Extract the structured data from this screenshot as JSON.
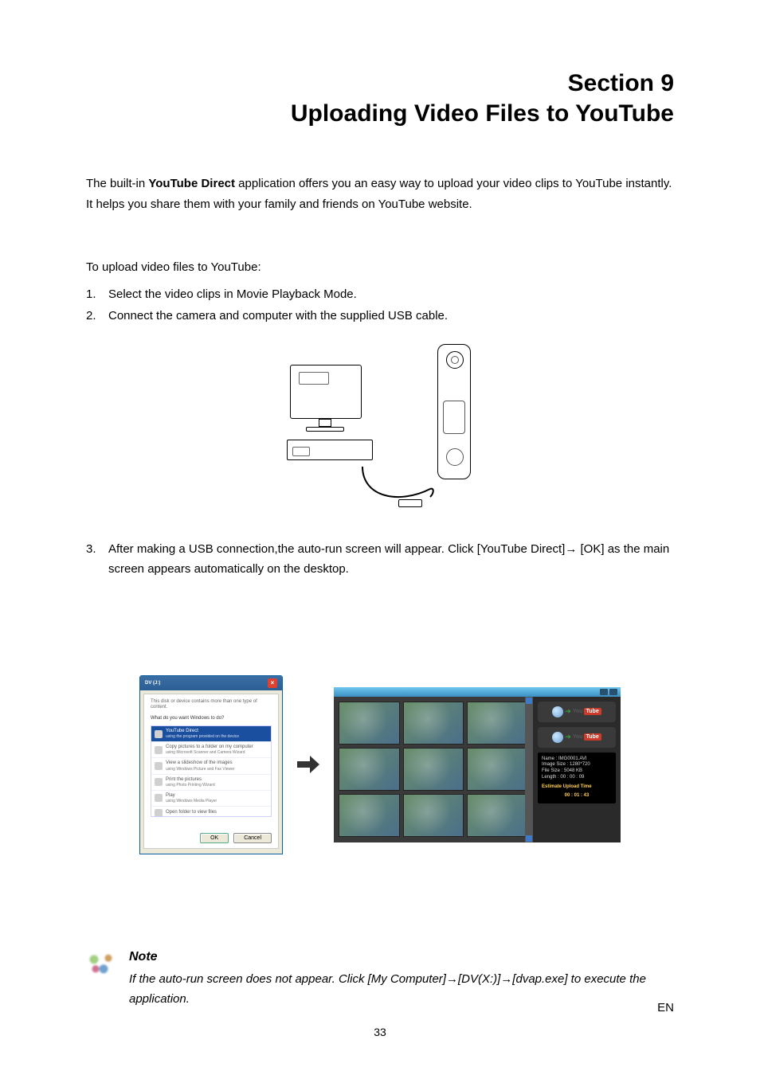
{
  "section": "Section 9",
  "title": "Uploading Video Files to YouTube",
  "intro": {
    "pre": "The built-in ",
    "bold": "YouTube Direct",
    "post": " application offers you an easy way to upload your video clips to YouTube instantly. It helps you share them with your family and friends on YouTube website."
  },
  "lead": "To upload video files to YouTube:",
  "steps": [
    {
      "num": "1.",
      "text": "Select the video clips in Movie Playback Mode."
    },
    {
      "num": "2.",
      "text": "Connect the camera and computer with the supplied USB cable."
    }
  ],
  "step3": {
    "num": "3.",
    "text": "After making a USB connection,the auto-run screen will appear. Click [YouTube Direct]→ [OK] as the main screen appears automatically on the desktop."
  },
  "dialog": {
    "title": "DV (J:)",
    "msg": "This disk or device contains more than one type of content.",
    "question": "What do you want Windows to do?",
    "options": [
      {
        "label": "YouTube Direct",
        "sub": "using the program provided on the device",
        "hl": true
      },
      {
        "label": "Copy pictures to a folder on my computer",
        "sub": "using Microsoft Scanner and Camera Wizard",
        "hl": false
      },
      {
        "label": "View a slideshow of the images",
        "sub": "using Windows Picture and Fax Viewer",
        "hl": false
      },
      {
        "label": "Print the pictures",
        "sub": "using Photo Printing Wizard",
        "hl": false
      },
      {
        "label": "Play",
        "sub": "using Windows Media Player",
        "hl": false
      },
      {
        "label": "Open folder to view files",
        "sub": "",
        "hl": false
      }
    ],
    "ok": "OK",
    "cancel": "Cancel"
  },
  "app": {
    "yt_you": "You",
    "yt_tube": "Tube",
    "meta_name": "Name : IMG0001.AVI",
    "meta_imgsize": "Image Size : 1280*720",
    "meta_fsize": "File Size : 5048 KB",
    "meta_len": "Length : 00 : 00 : 09",
    "meta_eta_label": "Estimate Upload Time",
    "meta_eta": "00 : 01 : 43"
  },
  "note": {
    "title": "Note",
    "text": "If the auto-run screen does not appear. Click [My Computer]→[DV(X:)]→[dvap.exe] to execute the application."
  },
  "page_number": "33",
  "lang": "EN"
}
